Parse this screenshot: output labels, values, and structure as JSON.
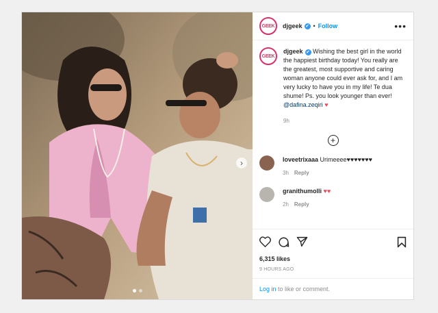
{
  "post": {
    "username": "djgeek",
    "logo_text": "GEEK",
    "verified_glyph": "✔",
    "separator": "•",
    "follow_label": "Follow",
    "more_glyph": "•••",
    "caption": {
      "username": "djgeek",
      "text": " Wishing the best girl in the world the happiest birthday today! You really are the greatest, most supportive and caring woman anyone could ever ask for, and I am very lucky to have you in my life! Te dua shume! Ps. you look younger than ever! ",
      "mention": "@dafina.zeqiri",
      "emoji": "♥",
      "time": "9h"
    },
    "load_more_glyph": "+",
    "comments": [
      {
        "username": "loveetrixaaa",
        "text": " Urimeeee♥♥♥♥♥♥♥",
        "time": "3h",
        "reply": "Reply"
      },
      {
        "username": "granithumolli",
        "text": " ♥♥",
        "time": "2h",
        "reply": "Reply"
      }
    ],
    "likes": "6,315 likes",
    "posted_ago": "9 HOURS AGO",
    "login_link": "Log in",
    "login_rest": " to like or comment.",
    "next_glyph": "›"
  },
  "icons": {
    "like": "heart-icon",
    "comment": "comment-icon",
    "share": "share-icon",
    "save": "bookmark-icon"
  },
  "colors": {
    "accent": "#0095f6",
    "verified": "#3897f0",
    "heart": "#ed4956",
    "logo_ring": "#d7316a"
  }
}
